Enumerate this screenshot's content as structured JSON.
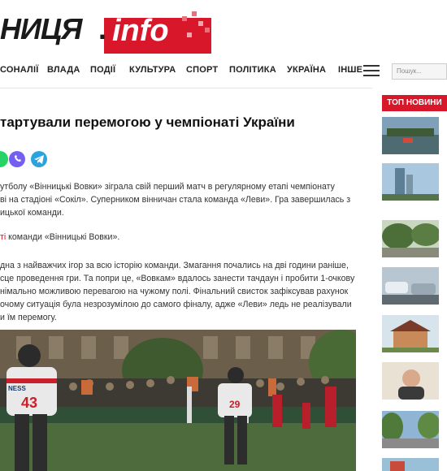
{
  "header": {
    "logo_text_cyr": "НИЦЯ",
    "logo_dot": ".",
    "logo_text_info": "info"
  },
  "nav": {
    "items": [
      "СОНАЛІЇ",
      "ВЛАДА",
      "ПОДІЇ",
      "КУЛЬТУРА",
      "СПОРТ",
      "ПОЛІТИКА",
      "УКРАЇНА",
      "ІНШЕ"
    ],
    "search_placeholder": "Пошук..."
  },
  "article": {
    "title": "тартували перемогою у чемпіонаті України",
    "paragraphs": [
      {
        "lines": [
          "утболу «Вінницькі Вовки» зіграла свій перший матч в регулярному етапі чемпіонату",
          "ві на стадіоні «Сокіл». Суперником вінничан стала команда «Леви». Гра завершилась з",
          "ицької команди."
        ]
      },
      {
        "link": "ті",
        "rest": " команди «Вінницькі Вовки»."
      },
      {
        "lines": [
          "дна з найважчих ігор за всю історію команди. Змагання почались на дві години раніше,",
          "сце проведення гри. Та попри це, «Вовкам» вдалось занести тачдаун і пробити 1-очкову",
          "німально можливою перевагою на чужому полі. Фінальний свисток зафіксував рахунок",
          "очому ситуація була незрозумілою до самого фіналу, адже «Леви» ледь не реалізували",
          "и їм перемогу."
        ]
      }
    ],
    "hero_jersey_left": "43",
    "hero_jersey_right": "29",
    "hero_banner_text": "NESS"
  },
  "sidebar": {
    "top_news_label": "ТОП НОВИНИ",
    "thumbs": [
      {
        "icon": "river-photo"
      },
      {
        "icon": "tower-photo"
      },
      {
        "icon": "park-photo"
      },
      {
        "icon": "cars-photo"
      },
      {
        "icon": "house-photo"
      },
      {
        "icon": "portrait-photo"
      },
      {
        "icon": "street-photo"
      },
      {
        "icon": "building-photo"
      }
    ]
  },
  "colors": {
    "brand_red": "#d8182a",
    "whatsapp": "#25d366",
    "viber": "#7360f2",
    "telegram": "#2aa3df"
  }
}
